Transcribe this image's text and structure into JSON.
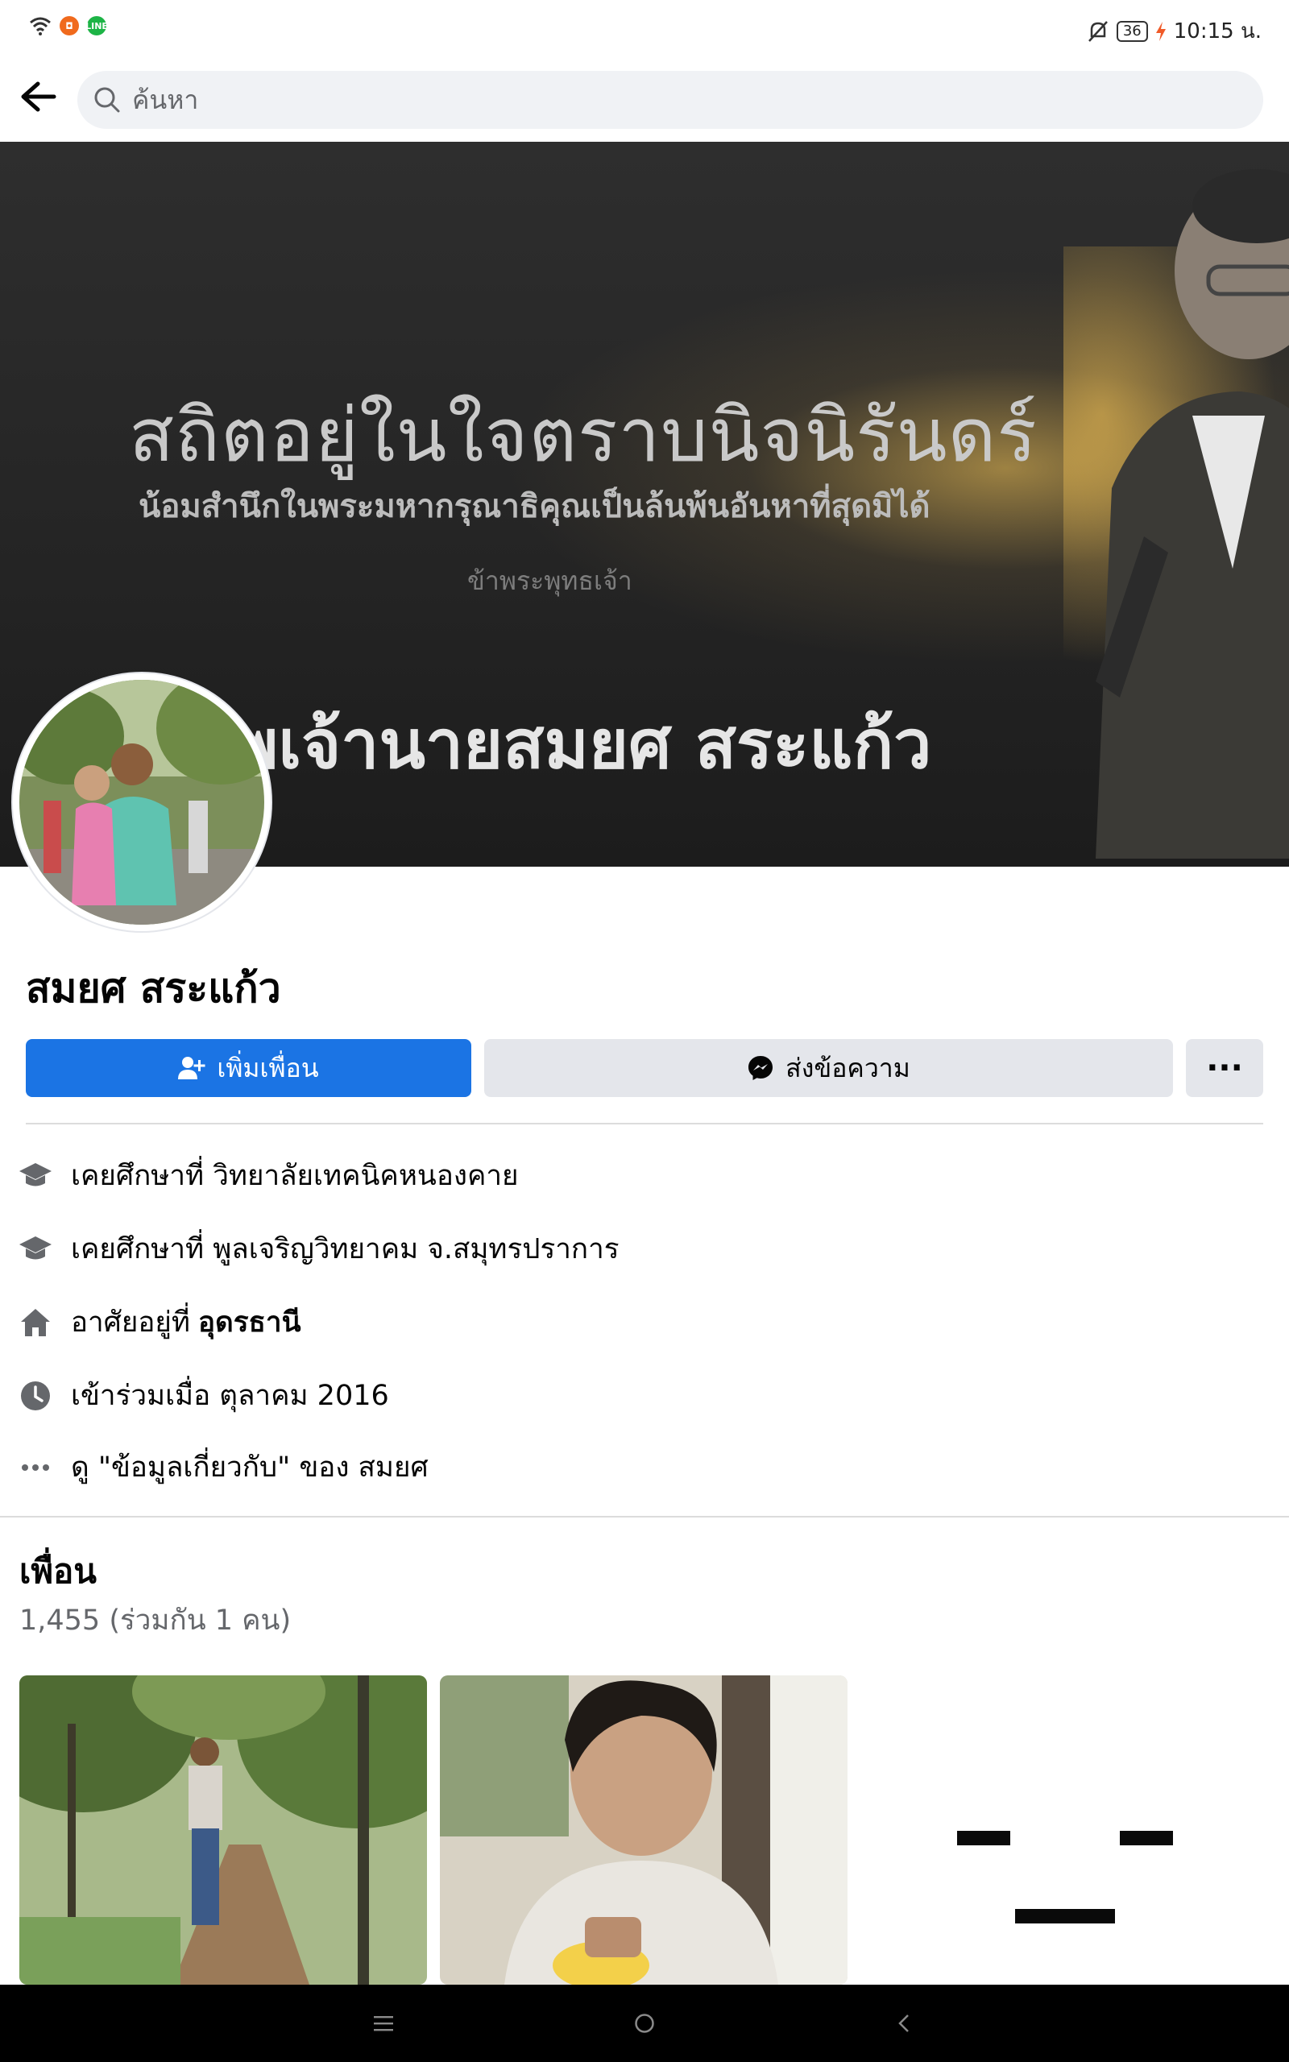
{
  "status_bar": {
    "time": "10:15 น.",
    "battery": "36",
    "icons": [
      "wifi-icon",
      "app-notification-icon",
      "line-app-icon",
      "mute-icon",
      "charging-icon"
    ]
  },
  "search": {
    "placeholder": "ค้นหา"
  },
  "cover": {
    "title": "สถิตอยู่ในใจตราบนิจนิรันดร์",
    "subtitle": "น้อมสำนึกในพระมหากรุณาธิคุณเป็นล้นพ้นอันหาที่สุดมิได้",
    "small": "ข้าพระพุทธเจ้า",
    "name": "พเจ้านายสมยศ สระแก้ว"
  },
  "profile": {
    "name": "สมยศ สระแก้ว",
    "add_friend_label": "เพิ่มเพื่อน",
    "message_label": "ส่งข้อความ",
    "more_label": "···"
  },
  "info": {
    "education_1": "เคยศึกษาที่ วิทยาลัยเทคนิคหนองคาย",
    "education_2": "เคยศึกษาที่ พูลเจริญวิทยาคม จ.สมุทรปราการ",
    "lives_prefix": "อาศัยอยู่ที่",
    "lives_city": "อุดรธานี",
    "joined": "เข้าร่วมเมื่อ ตุลาคม  2016",
    "about": "ดู \"ข้อมูลเกี่ยวกับ\" ของ สมยศ"
  },
  "friends": {
    "title": "เพื่อน",
    "count": "1,455 (ร่วมกัน 1 คน)"
  },
  "colors": {
    "primary": "#1b74e4",
    "secondary_button": "#e4e6eb",
    "search_bg": "#f0f2f5",
    "muted_text": "#65676b"
  }
}
